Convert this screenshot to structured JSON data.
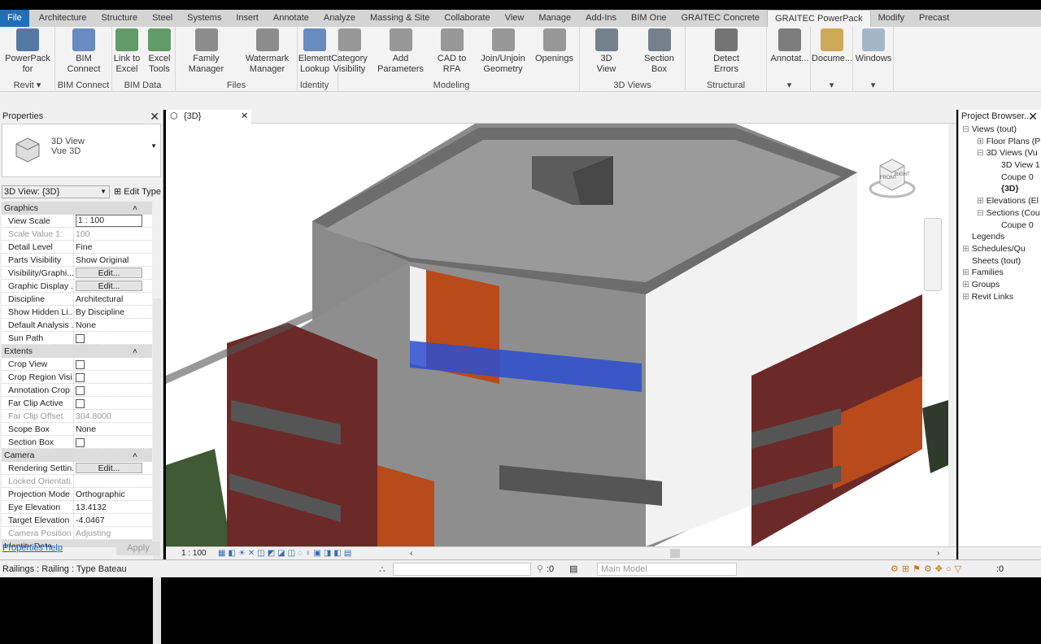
{
  "ribbon_tabs": [
    "File",
    "Architecture",
    "Structure",
    "Steel",
    "Systems",
    "Insert",
    "Annotate",
    "Analyze",
    "Massing & Site",
    "Collaborate",
    "View",
    "Manage",
    "Add-Ins",
    "BIM One",
    "GRAITEC Concrete",
    "GRAITEC PowerPack",
    "Modify",
    "Precast"
  ],
  "active_tab": "GRAITEC PowerPack",
  "panels": [
    {
      "label": "Revit ▾",
      "buttons": [
        "PowerPack\nfor"
      ]
    },
    {
      "label": "BIM Connect",
      "buttons": [
        "BIM\nConnect"
      ]
    },
    {
      "label": "BIM Data",
      "buttons": [
        "Link to\nExcel",
        "Excel\nTools"
      ]
    },
    {
      "label": "Files",
      "buttons": [
        "Family\nManager",
        "Watermark\nManager"
      ]
    },
    {
      "label": "Identity",
      "buttons": [
        "Element\nLookup"
      ]
    },
    {
      "label": "Modeling",
      "buttons": [
        "Category\nVisibility",
        "Add\nParameters",
        "CAD to\nRFA",
        "Join/Unjoin\nGeometry",
        "Openings"
      ]
    },
    {
      "label": "3D Views",
      "buttons": [
        "3D\nView",
        "Section\nBox"
      ]
    },
    {
      "label": "Structural",
      "buttons": [
        "Detect\nErrors"
      ]
    },
    {
      "label": "▾",
      "buttons": [
        "Annotat..."
      ]
    },
    {
      "label": "▾",
      "buttons": [
        "Docume..."
      ]
    },
    {
      "label": "▾",
      "buttons": [
        "Windows"
      ]
    }
  ],
  "properties": {
    "title": "Properties",
    "type_name": "3D View",
    "type_sub": "Vue 3D",
    "instance_selector": "3D View: {3D}",
    "edit_type": "Edit Type",
    "sections": [
      {
        "name": "Graphics",
        "rows": [
          {
            "k": "View Scale",
            "v": "1 : 100",
            "kind": "input"
          },
          {
            "k": "Scale Value    1:",
            "v": "100",
            "kind": "disabled"
          },
          {
            "k": "Detail Level",
            "v": "Fine"
          },
          {
            "k": "Parts Visibility",
            "v": "Show Original"
          },
          {
            "k": "Visibility/Graphi...",
            "v": "Edit...",
            "kind": "button"
          },
          {
            "k": "Graphic Display ...",
            "v": "Edit...",
            "kind": "button"
          },
          {
            "k": "Discipline",
            "v": "Architectural"
          },
          {
            "k": "Show Hidden Li...",
            "v": "By Discipline"
          },
          {
            "k": "Default Analysis ...",
            "v": "None"
          },
          {
            "k": "Sun Path",
            "v": "",
            "kind": "checkbox"
          }
        ]
      },
      {
        "name": "Extents",
        "rows": [
          {
            "k": "Crop View",
            "v": "",
            "kind": "checkbox"
          },
          {
            "k": "Crop Region Visi...",
            "v": "",
            "kind": "checkbox"
          },
          {
            "k": "Annotation Crop",
            "v": "",
            "kind": "checkbox"
          },
          {
            "k": "Far Clip Active",
            "v": "",
            "kind": "checkbox"
          },
          {
            "k": "Far Clip Offset",
            "v": "304.8000",
            "kind": "disabled"
          },
          {
            "k": "Scope Box",
            "v": "None"
          },
          {
            "k": "Section Box",
            "v": "",
            "kind": "checkbox"
          }
        ]
      },
      {
        "name": "Camera",
        "rows": [
          {
            "k": "Rendering Settin...",
            "v": "Edit...",
            "kind": "button"
          },
          {
            "k": "Locked Orientati...",
            "v": "",
            "kind": "disabled"
          },
          {
            "k": "Projection Mode",
            "v": "Orthographic"
          },
          {
            "k": "Eye Elevation",
            "v": "13.4132"
          },
          {
            "k": "Target Elevation",
            "v": "-4.0467"
          },
          {
            "k": "Camera Position",
            "v": "Adjusting",
            "kind": "disabled"
          }
        ]
      },
      {
        "name": "Identity Data",
        "rows": []
      }
    ],
    "help": "Properties help",
    "apply": "Apply"
  },
  "view_tab": "{3D}",
  "view_scale": "1 : 100",
  "viewcube": {
    "front": "FRONT",
    "right": "RIGHT"
  },
  "project_browser": {
    "title": "Project Browser...",
    "items": [
      {
        "label": "Views (tout)",
        "depth": 0,
        "exp": "-"
      },
      {
        "label": "Floor Plans (P",
        "depth": 1,
        "exp": "+"
      },
      {
        "label": "3D Views (Vu",
        "depth": 1,
        "exp": "-"
      },
      {
        "label": "3D View 1",
        "depth": 2
      },
      {
        "label": "Coupe 0",
        "depth": 2
      },
      {
        "label": "{3D}",
        "depth": 2,
        "bold": true
      },
      {
        "label": "Elevations (El",
        "depth": 1,
        "exp": "+"
      },
      {
        "label": "Sections (Cou",
        "depth": 1,
        "exp": "-"
      },
      {
        "label": "Coupe 0",
        "depth": 2
      },
      {
        "label": "Legends",
        "depth": 0
      },
      {
        "label": "Schedules/Qu",
        "depth": 0,
        "exp": "+"
      },
      {
        "label": "Sheets (tout)",
        "depth": 0
      },
      {
        "label": "Families",
        "depth": 0,
        "exp": "+"
      },
      {
        "label": "Groups",
        "depth": 0,
        "exp": "+"
      },
      {
        "label": "Revit Links",
        "depth": 0,
        "exp": "+"
      }
    ]
  },
  "status": {
    "text": "Railings : Railing : Type Bateau",
    "workset_count": ":0",
    "model": "Main Model",
    "filter_count": ":0"
  },
  "colors": {
    "file_tab": "#1e6fb8",
    "selection": "#2a4fd0",
    "brick": "#6b2a28",
    "orange": "#b84a1c"
  }
}
